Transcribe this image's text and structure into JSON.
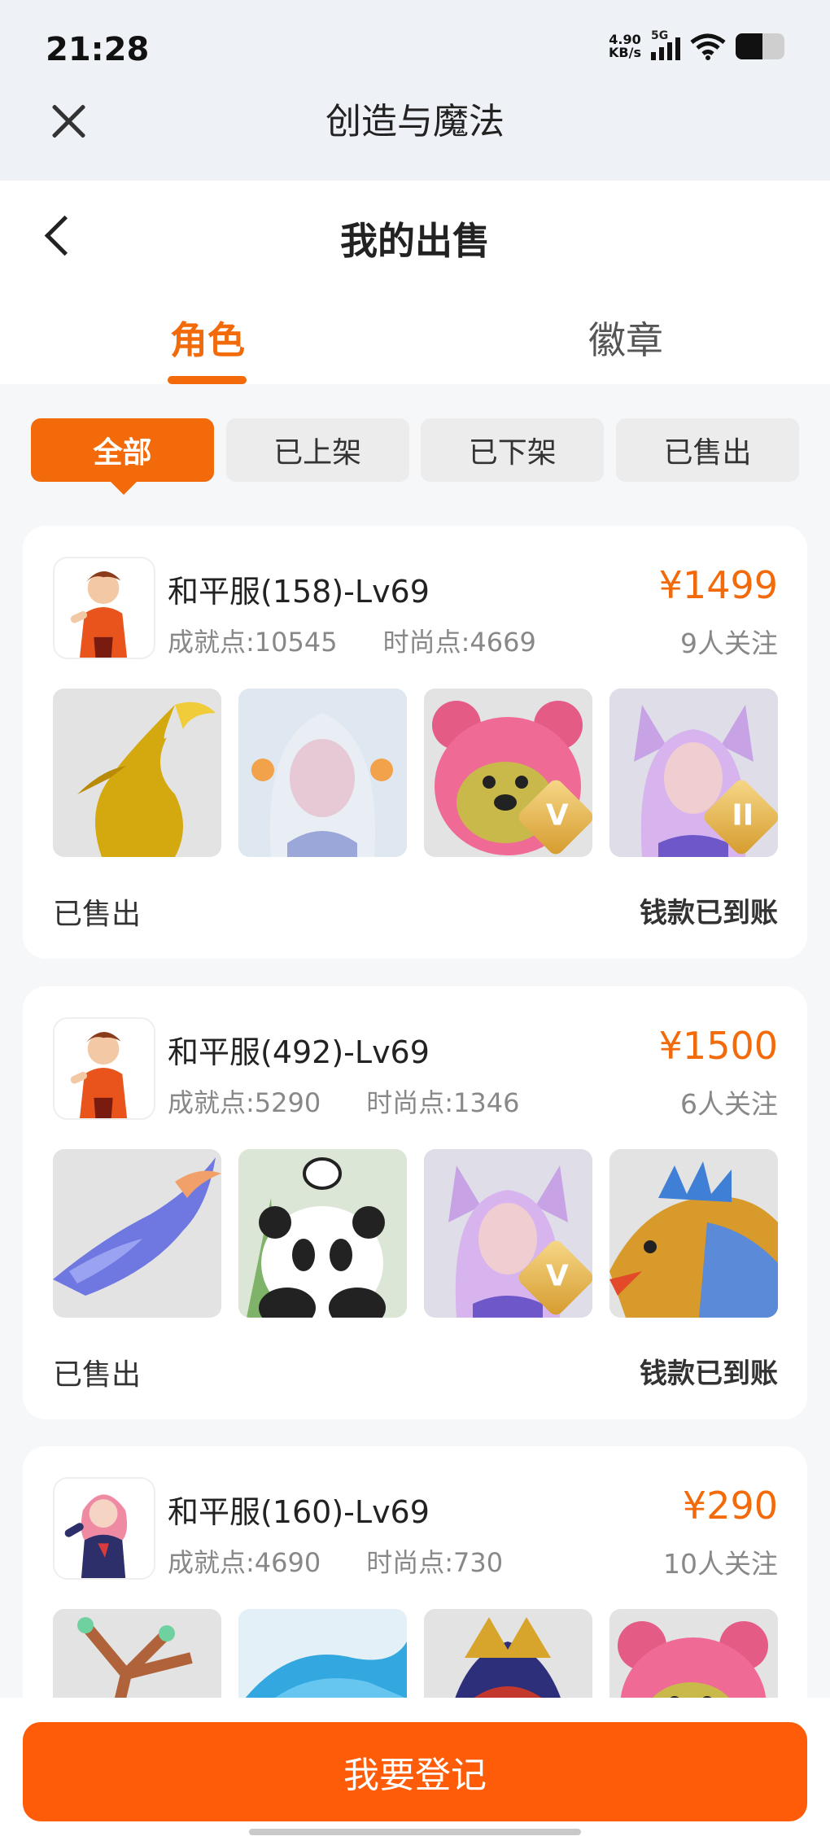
{
  "status_bar": {
    "time": "21:28",
    "net_speed_value": "4.90",
    "net_speed_unit": "KB/s",
    "network": "5G",
    "battery_level": 0.55
  },
  "app_bar": {
    "title": "创造与魔法",
    "close_icon": "close-icon"
  },
  "page": {
    "title": "我的出售",
    "back_icon": "chevron-left-icon",
    "tabs": [
      {
        "label": "角色",
        "active": true
      },
      {
        "label": "徽章",
        "active": false
      }
    ],
    "filters": [
      {
        "label": "全部",
        "active": true
      },
      {
        "label": "已上架",
        "active": false
      },
      {
        "label": "已下架",
        "active": false
      },
      {
        "label": "已售出",
        "active": false
      }
    ]
  },
  "listings": [
    {
      "name": "和平服(158)-Lv69",
      "achievement": "成就点:10545",
      "fashion": "时尚点:4669",
      "price": "¥1499",
      "watchers": "9人关注",
      "status": "已售出",
      "payment": "钱款已到账",
      "thumbs": [
        {
          "icon": "golden-dragon-pet",
          "badge": ""
        },
        {
          "icon": "silver-haired-fairy",
          "badge": ""
        },
        {
          "icon": "pink-bear-mount",
          "badge": "V"
        },
        {
          "icon": "fox-ear-girl-skin",
          "badge": "II"
        }
      ]
    },
    {
      "name": "和平服(492)-Lv69",
      "achievement": "成就点:5290",
      "fashion": "时尚点:1346",
      "price": "¥1500",
      "watchers": "6人关注",
      "status": "已售出",
      "payment": "钱款已到账",
      "thumbs": [
        {
          "icon": "blue-dragon-pet",
          "badge": ""
        },
        {
          "icon": "panda-pet",
          "badge": ""
        },
        {
          "icon": "fox-ear-girl-skin",
          "badge": "V"
        },
        {
          "icon": "armored-dragon-mount",
          "badge": ""
        }
      ]
    },
    {
      "name": "和平服(160)-Lv69",
      "achievement": "成就点:4690",
      "fashion": "时尚点:730",
      "price": "¥290",
      "watchers": "10人关注",
      "status": "",
      "payment": "",
      "thumbs": [
        {
          "icon": "antler-tree-pet",
          "badge": ""
        },
        {
          "icon": "blue-water-mount",
          "badge": ""
        },
        {
          "icon": "dark-dragon-mount",
          "badge": ""
        },
        {
          "icon": "pink-bear-mount",
          "badge": ""
        }
      ]
    }
  ],
  "bottom": {
    "cta_label": "我要登记"
  },
  "colors": {
    "accent": "#f26a0a",
    "cta": "#ff5c0a",
    "price": "#f26a0a"
  }
}
